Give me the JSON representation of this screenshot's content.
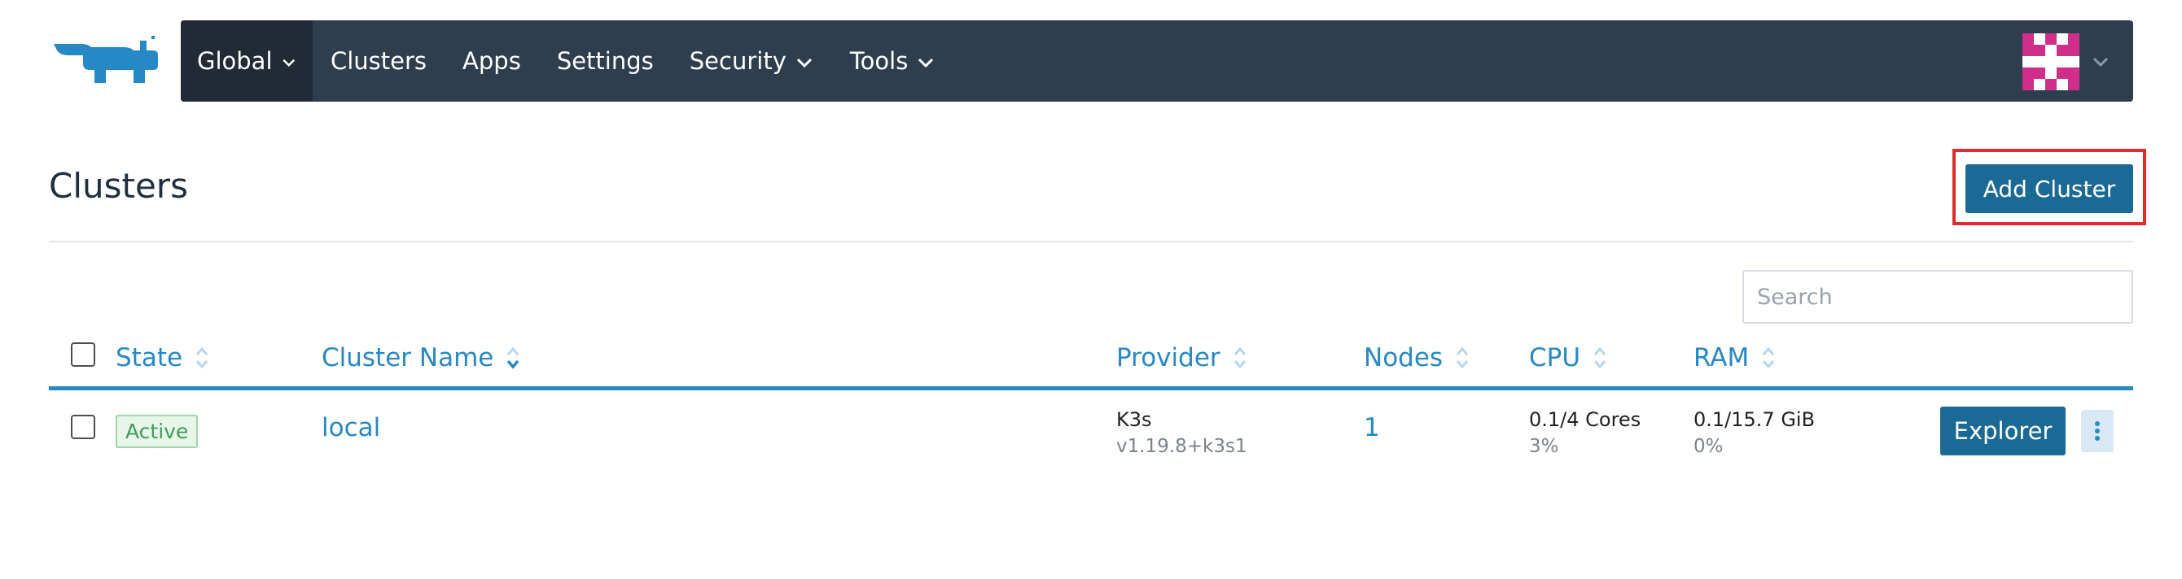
{
  "nav": {
    "items": [
      {
        "label": "Global",
        "has_dropdown": true,
        "active": true
      },
      {
        "label": "Clusters",
        "has_dropdown": false
      },
      {
        "label": "Apps",
        "has_dropdown": false
      },
      {
        "label": "Settings",
        "has_dropdown": false
      },
      {
        "label": "Security",
        "has_dropdown": true
      },
      {
        "label": "Tools",
        "has_dropdown": true
      }
    ],
    "logo_icon": "rancher-logo-icon",
    "avatar_icon": "user-avatar-identicon",
    "colors": {
      "bar": "#2e3e4f",
      "active": "#222b35",
      "logo": "#2688c4",
      "avatar": "#d12e8c"
    }
  },
  "page": {
    "title": "Clusters",
    "add_button": "Add Cluster",
    "highlight_color": "#e22b2b",
    "button_color": "#1b6a96"
  },
  "search": {
    "placeholder": "Search",
    "value": ""
  },
  "table": {
    "columns": [
      "State",
      "Cluster Name",
      "Provider",
      "Nodes",
      "CPU",
      "RAM"
    ],
    "sorted_by": "Cluster Name",
    "rows": [
      {
        "state": "Active",
        "name": "local",
        "provider": "K3s",
        "provider_version": "v1.19.8+k3s1",
        "nodes": "1",
        "cpu": "0.1/4 Cores",
        "cpu_pct": "3%",
        "ram": "0.1/15.7 GiB",
        "ram_pct": "0%",
        "action": "Explorer"
      }
    ]
  }
}
